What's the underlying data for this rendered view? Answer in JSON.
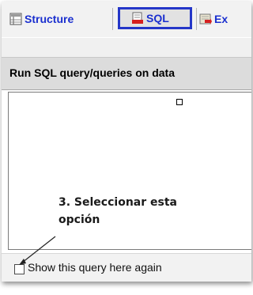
{
  "tabs": {
    "structure_label": "Structure",
    "sql_label": "SQL",
    "export_label": "Ex"
  },
  "query_panel": {
    "caption": "Run SQL query/queries on data"
  },
  "annotation": {
    "line1": "3. Seleccionar esta",
    "line2": "opción"
  },
  "options": {
    "show_query_label": "Show this query here again",
    "show_query_checked": false
  },
  "colors": {
    "tab_text": "#1a2fcf",
    "highlight_border": "#2436c8"
  },
  "icons": [
    "structure-icon",
    "sql-icon",
    "export-icon"
  ]
}
